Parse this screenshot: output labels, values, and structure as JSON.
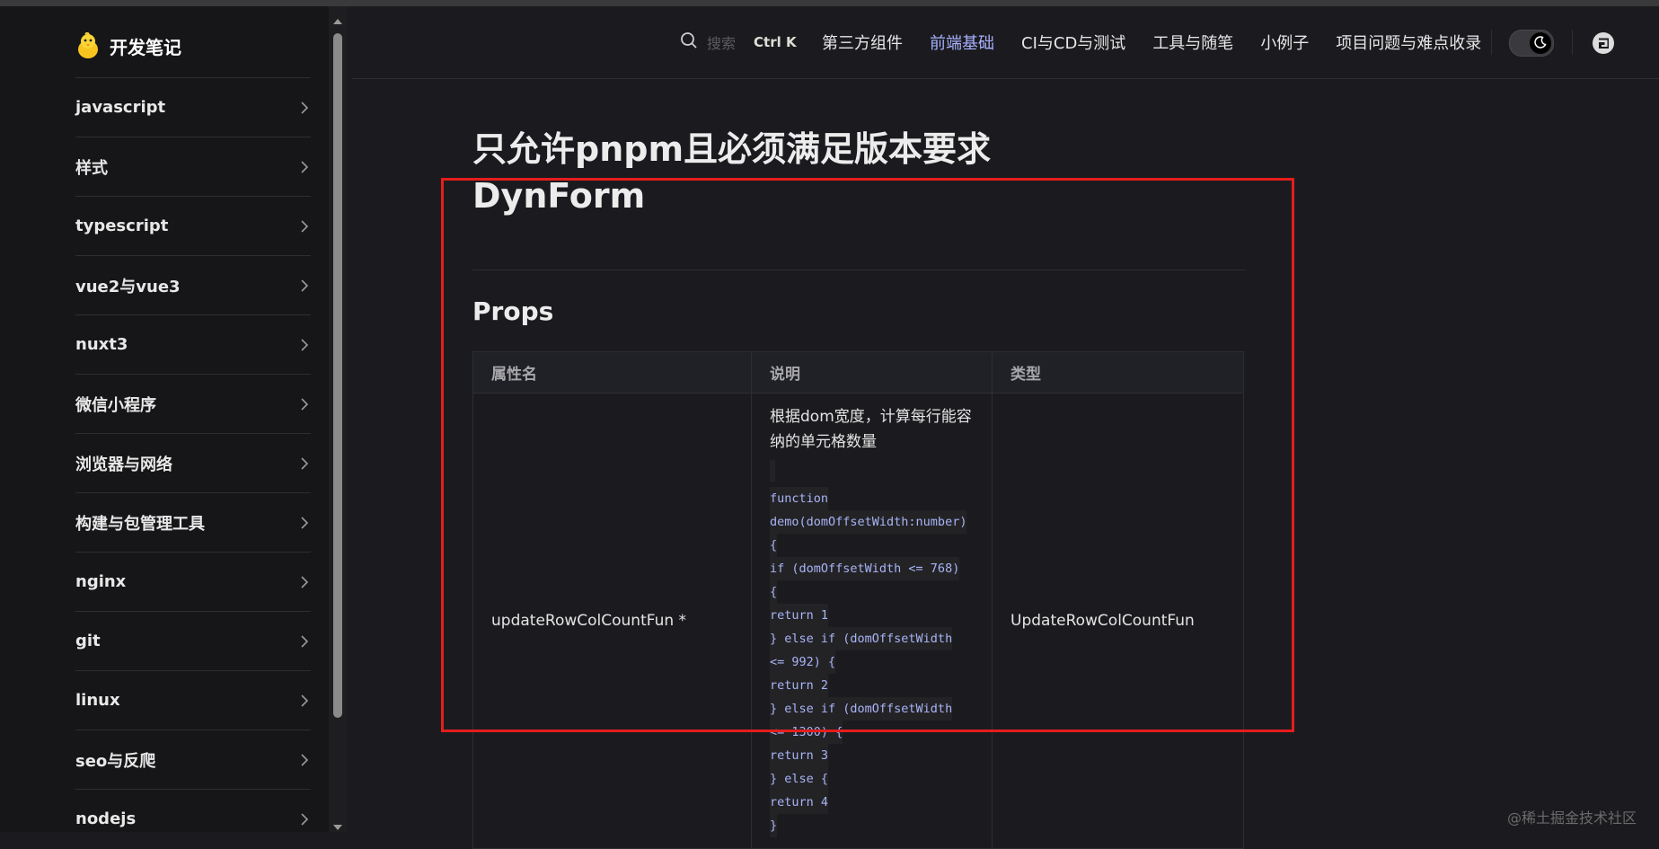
{
  "brand": {
    "title": "开发笔记",
    "logo_icon": "chick-logo"
  },
  "sidebar": {
    "items": [
      {
        "label": "javascript"
      },
      {
        "label": "样式"
      },
      {
        "label": "typescript"
      },
      {
        "label": "vue2与vue3"
      },
      {
        "label": "nuxt3"
      },
      {
        "label": "微信小程序"
      },
      {
        "label": "浏览器与网络"
      },
      {
        "label": "构建与包管理工具"
      },
      {
        "label": "nginx"
      },
      {
        "label": "git"
      },
      {
        "label": "linux"
      },
      {
        "label": "seo与反爬"
      },
      {
        "label": "nodejs"
      }
    ]
  },
  "nav": {
    "search_placeholder": "搜索",
    "search_shortcut": "Ctrl K",
    "links": [
      {
        "label": "第三方组件",
        "active": false
      },
      {
        "label": "前端基础",
        "active": true
      },
      {
        "label": "CI与CD与测试",
        "active": false
      },
      {
        "label": "工具与随笔",
        "active": false
      },
      {
        "label": "小例子",
        "active": false
      },
      {
        "label": "项目问题与难点收录",
        "active": false
      }
    ],
    "theme_toggle_icon": "moon-icon",
    "repo_icon": "gitee-icon",
    "active_color": "#a8b1ff"
  },
  "content": {
    "heading1": "只允许pnpm且必须满足版本要求",
    "heading2": "DynForm",
    "heading3": "Props",
    "table": {
      "headers": [
        "属性名",
        "说明",
        "类型"
      ],
      "rows": [
        {
          "name": "updateRowColCountFun *",
          "description": "根据dom宽度，计算每行能容纳的单元格数量",
          "code": [
            "function",
            "demo(domOffsetWidth:number)",
            "{",
            "if (domOffsetWidth <= 768)",
            "{",
            "return 1",
            "} else if (domOffsetWidth",
            "<= 992) {",
            "return 2",
            "} else if (domOffsetWidth",
            "<= 1300) {",
            "return 3",
            "} else {",
            "return 4",
            "}"
          ],
          "type": "UpdateRowColCountFun"
        }
      ]
    }
  },
  "watermark": "@稀土掘金技术社区",
  "highlight_color": "#e51d1d"
}
